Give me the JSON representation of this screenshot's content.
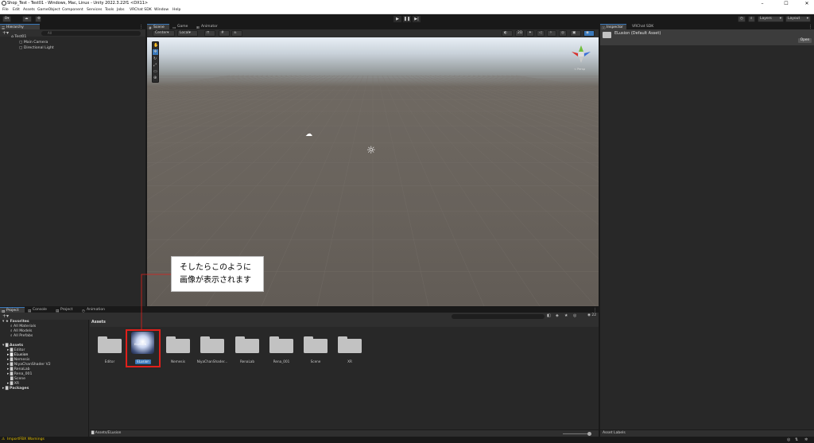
{
  "window": {
    "title": "Shop_Test - Test01 - Windows, Mac, Linux - Unity 2022.3.22f1 <DX11>",
    "controls": [
      "–",
      "☐",
      "✕"
    ]
  },
  "menu": [
    "File",
    "Edit",
    "Assets",
    "GameObject",
    "Component",
    "Services",
    "Tools",
    "Jobs",
    "VRChat SDK",
    "Window",
    "Help"
  ],
  "toolbar": {
    "account": "B",
    "layers_label": "Layers",
    "layout_label": "Layout"
  },
  "hierarchy": {
    "tab": "Hierarchy",
    "search_placeholder": "All",
    "scene_name": "Test01",
    "items": [
      "Main Camera",
      "Directional Light"
    ]
  },
  "scene": {
    "tabs": [
      "Scene",
      "Game",
      "Animator"
    ],
    "pivot_label": "Center",
    "space_label": "Local",
    "mode_2d": "2D",
    "axis_label": "≺ Persp"
  },
  "inspector": {
    "tabs": [
      "Inspector",
      "VRChat SDK"
    ],
    "asset_title": "ELusion (Default Asset)",
    "open_button": "Open",
    "asset_labels": "Asset Labels"
  },
  "project": {
    "tabs": [
      "Project",
      "Console",
      "Project",
      "Animation"
    ],
    "breadcrumb": "Assets",
    "path": "Assets/ELusion",
    "count": "22",
    "favorites_label": "Favorites",
    "favorites": [
      "All Materials",
      "All Models",
      "All Prefabs"
    ],
    "assets_label": "Assets",
    "tree": [
      "Editor",
      "ELusion",
      "Nemesis",
      "NiyaChanShader V2",
      "RenaLab",
      "Rena_001",
      "Scene",
      "XR"
    ],
    "packages_label": "Packages",
    "grid": [
      {
        "label": "Editor",
        "kind": "folder"
      },
      {
        "label": "ELusion",
        "kind": "image"
      },
      {
        "label": "Nemesis",
        "kind": "folder"
      },
      {
        "label": "NiyaChanShader...",
        "kind": "folder"
      },
      {
        "label": "RenaLab",
        "kind": "folder"
      },
      {
        "label": "Rena_001",
        "kind": "folder"
      },
      {
        "label": "Scene",
        "kind": "folder"
      },
      {
        "label": "XR",
        "kind": "folder"
      }
    ]
  },
  "status": {
    "warning": "ImportFBX Warnings"
  },
  "callout": {
    "line1": "そしたらこのように",
    "line2": "画像が表示されます"
  },
  "colors": {
    "accent": "#3a79bb",
    "highlight_box": "#e0201b",
    "panel": "#282828",
    "chrome": "#191919",
    "folder": "#c2c2c2"
  }
}
